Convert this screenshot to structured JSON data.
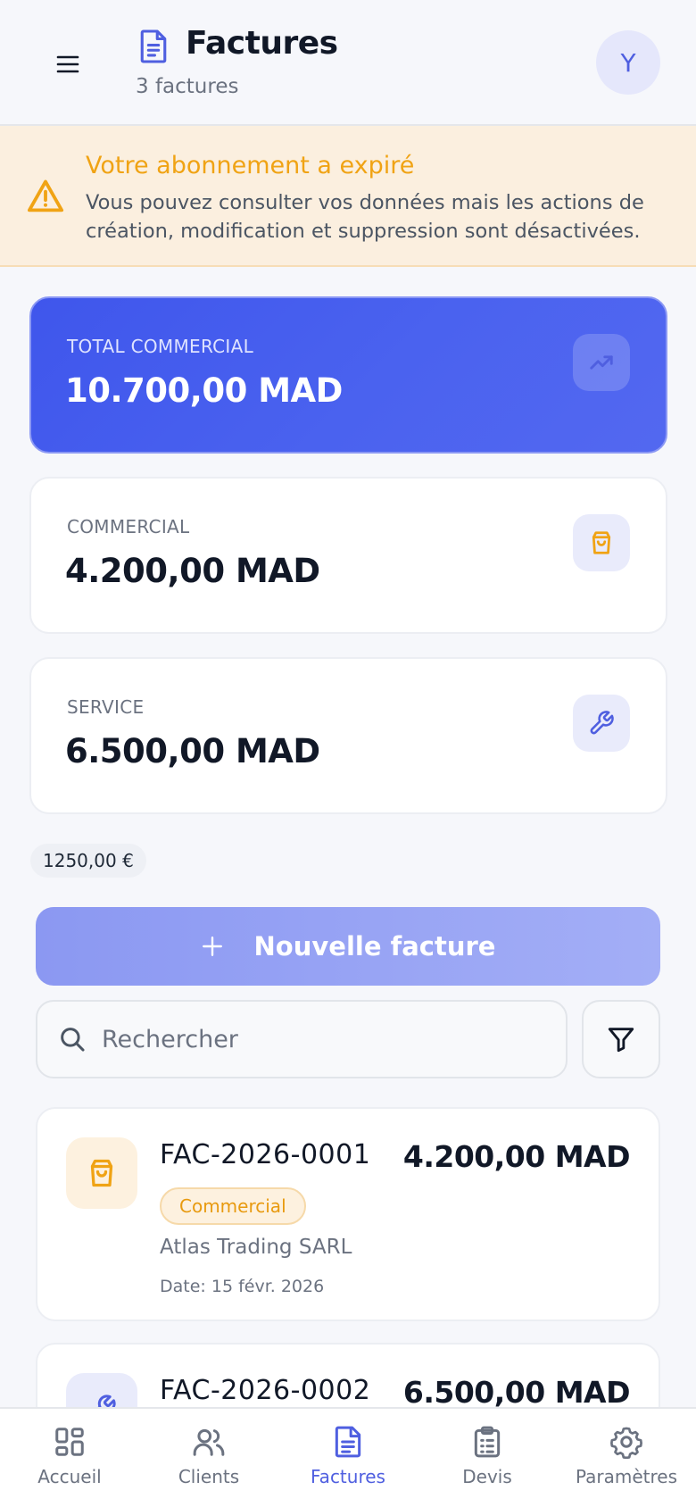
{
  "header": {
    "title": "Factures",
    "subtitle": "3 factures",
    "avatar_initial": "Y",
    "menu_icon": "hamburger-menu-icon",
    "title_icon": "document-icon"
  },
  "banner": {
    "title": "Votre abonnement a expiré",
    "message": "Vous pouvez consulter vos données mais les actions de création, modification et suppression sont désactivées.",
    "icon": "warning-triangle-icon",
    "color": "#f0a314"
  },
  "summary_cards": [
    {
      "label": "TOTAL COMMERCIAL",
      "value": "10.700,00 MAD",
      "icon": "trending-up-icon"
    },
    {
      "label": "COMMERCIAL",
      "value": "4.200,00 MAD",
      "icon": "shopping-bag-icon"
    },
    {
      "label": "SERVICE",
      "value": "6.500,00 MAD",
      "icon": "wrench-icon"
    }
  ],
  "amount_chip": "1250,00 €",
  "actions": {
    "new_invoice_label": "Nouvelle facture",
    "search_placeholder": "Rechercher",
    "filter_icon": "filter-icon"
  },
  "invoices": [
    {
      "number": "FAC-2026-0001",
      "amount": "4.200,00 MAD",
      "badge": "Commercial",
      "client": "Atlas Trading SARL",
      "date": "Date: 15 févr. 2026",
      "icon": "shopping-bag-icon"
    },
    {
      "number": "FAC-2026-0002",
      "amount": "6.500,00 MAD",
      "icon": "wrench-icon"
    }
  ],
  "tabs": [
    {
      "label": "Accueil",
      "icon": "dashboard-grid-icon",
      "active": false
    },
    {
      "label": "Clients",
      "icon": "users-icon",
      "active": false
    },
    {
      "label": "Factures",
      "icon": "document-icon",
      "active": true
    },
    {
      "label": "Devis",
      "icon": "clipboard-list-icon",
      "active": false
    },
    {
      "label": "Paramètres",
      "icon": "gear-icon",
      "active": false
    }
  ],
  "colors": {
    "primary": "#4f5fe0",
    "warning": "#f0a314",
    "background": "#f6f7fb"
  }
}
